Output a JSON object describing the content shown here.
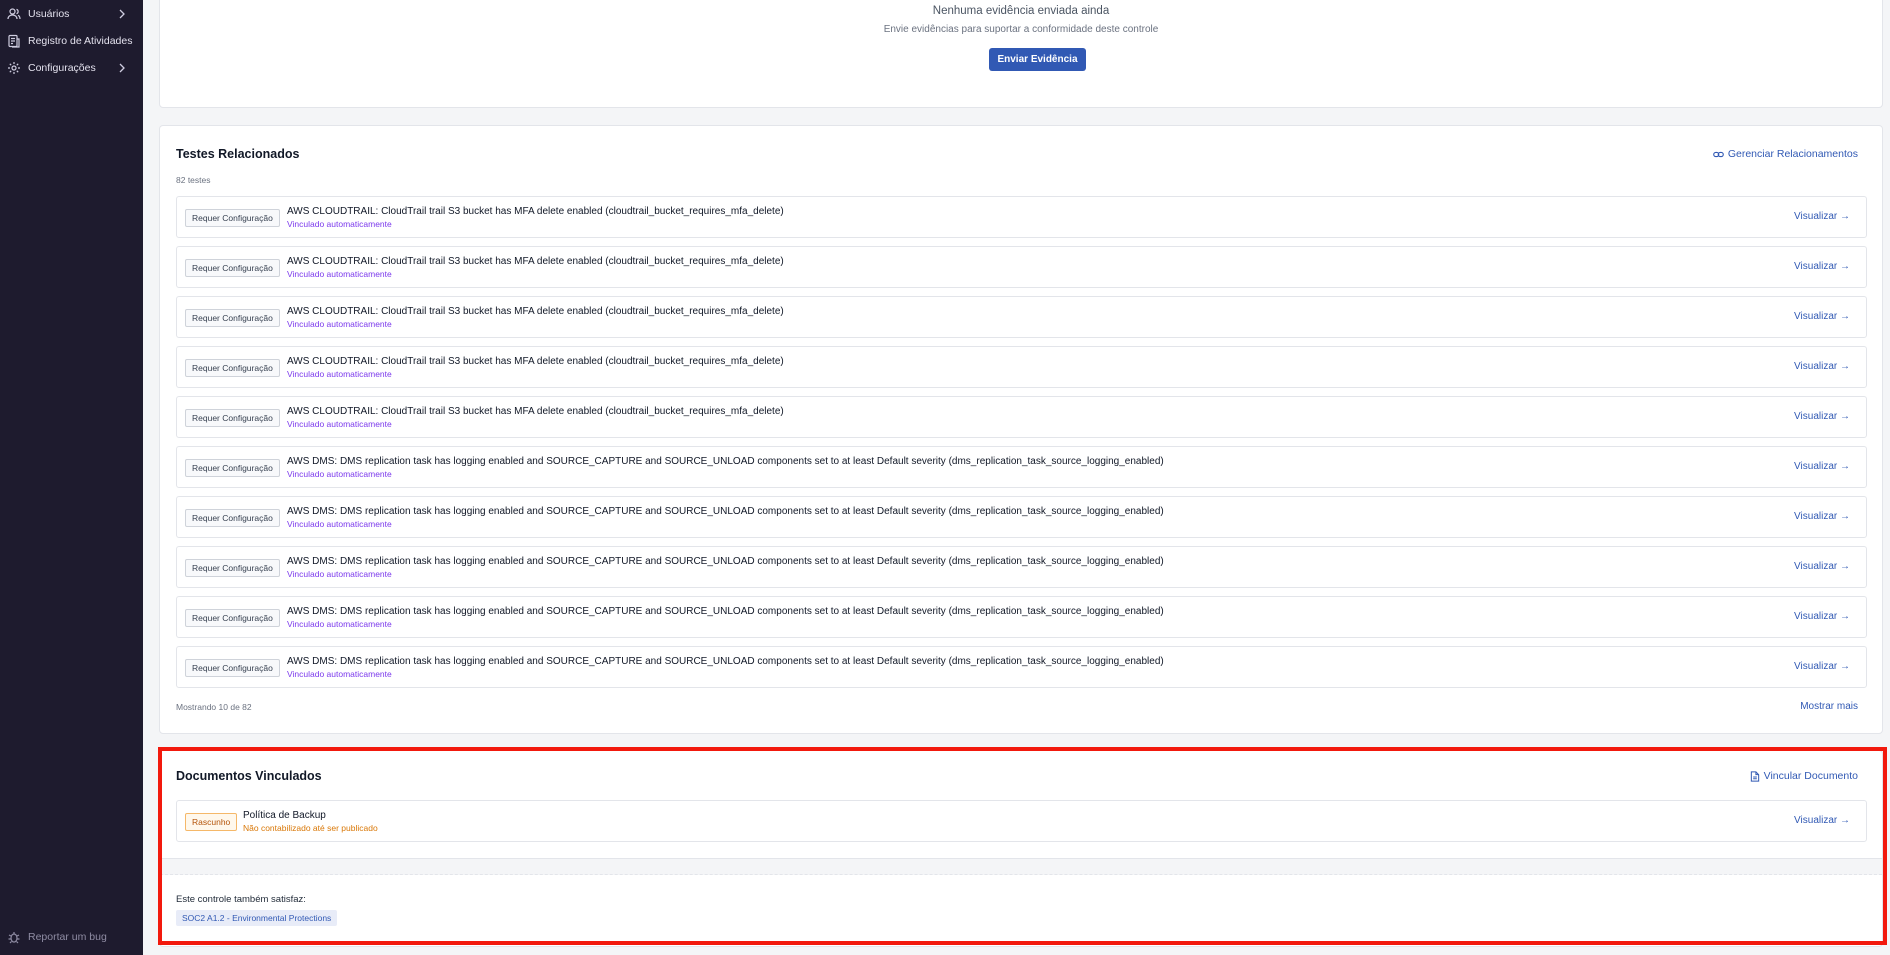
{
  "sidebar": {
    "items": [
      {
        "label": "Usuários",
        "icon": "users-icon",
        "has_chevron": true
      },
      {
        "label": "Registro de Atividades",
        "icon": "activity-log-icon",
        "has_chevron": false
      },
      {
        "label": "Configurações",
        "icon": "gear-icon",
        "has_chevron": true
      }
    ],
    "bottom": {
      "label": "Reportar um bug",
      "icon": "bug-icon"
    }
  },
  "evidence": {
    "empty_title": "Nenhuma evidência enviada ainda",
    "empty_subtitle": "Envie evidências para suportar a conformidade deste controle",
    "upload_button": "Enviar Evidência"
  },
  "tests": {
    "title": "Testes Relacionados",
    "manage_link": "Gerenciar Relacionamentos",
    "count": "82 testes",
    "items": [
      {
        "tag": "Requer Configuração",
        "title": "AWS CLOUDTRAIL: CloudTrail trail S3 bucket has MFA delete enabled (cloudtrail_bucket_requires_mfa_delete)",
        "subtitle": "Vinculado automaticamente",
        "action": "Visualizar →"
      },
      {
        "tag": "Requer Configuração",
        "title": "AWS CLOUDTRAIL: CloudTrail trail S3 bucket has MFA delete enabled (cloudtrail_bucket_requires_mfa_delete)",
        "subtitle": "Vinculado automaticamente",
        "action": "Visualizar →"
      },
      {
        "tag": "Requer Configuração",
        "title": "AWS CLOUDTRAIL: CloudTrail trail S3 bucket has MFA delete enabled (cloudtrail_bucket_requires_mfa_delete)",
        "subtitle": "Vinculado automaticamente",
        "action": "Visualizar →"
      },
      {
        "tag": "Requer Configuração",
        "title": "AWS CLOUDTRAIL: CloudTrail trail S3 bucket has MFA delete enabled (cloudtrail_bucket_requires_mfa_delete)",
        "subtitle": "Vinculado automaticamente",
        "action": "Visualizar →"
      },
      {
        "tag": "Requer Configuração",
        "title": "AWS CLOUDTRAIL: CloudTrail trail S3 bucket has MFA delete enabled (cloudtrail_bucket_requires_mfa_delete)",
        "subtitle": "Vinculado automaticamente",
        "action": "Visualizar →"
      },
      {
        "tag": "Requer Configuração",
        "title": "AWS DMS: DMS replication task has logging enabled and SOURCE_CAPTURE and SOURCE_UNLOAD components set to at least Default severity (dms_replication_task_source_logging_enabled)",
        "subtitle": "Vinculado automaticamente",
        "action": "Visualizar →"
      },
      {
        "tag": "Requer Configuração",
        "title": "AWS DMS: DMS replication task has logging enabled and SOURCE_CAPTURE and SOURCE_UNLOAD components set to at least Default severity (dms_replication_task_source_logging_enabled)",
        "subtitle": "Vinculado automaticamente",
        "action": "Visualizar →"
      },
      {
        "tag": "Requer Configuração",
        "title": "AWS DMS: DMS replication task has logging enabled and SOURCE_CAPTURE and SOURCE_UNLOAD components set to at least Default severity (dms_replication_task_source_logging_enabled)",
        "subtitle": "Vinculado automaticamente",
        "action": "Visualizar →"
      },
      {
        "tag": "Requer Configuração",
        "title": "AWS DMS: DMS replication task has logging enabled and SOURCE_CAPTURE and SOURCE_UNLOAD components set to at least Default severity (dms_replication_task_source_logging_enabled)",
        "subtitle": "Vinculado automaticamente",
        "action": "Visualizar →"
      },
      {
        "tag": "Requer Configuração",
        "title": "AWS DMS: DMS replication task has logging enabled and SOURCE_CAPTURE and SOURCE_UNLOAD components set to at least Default severity (dms_replication_task_source_logging_enabled)",
        "subtitle": "Vinculado automaticamente",
        "action": "Visualizar →"
      }
    ],
    "showing": "Mostrando 10 de 82",
    "show_more": "Mostrar mais"
  },
  "documents": {
    "title": "Documentos Vinculados",
    "link_action": "Vincular Documento",
    "items": [
      {
        "tag": "Rascunho",
        "title": "Política de Backup",
        "subtitle": "Não contabilizado até ser publicado",
        "action": "Visualizar →"
      }
    ],
    "also_satisfies_label": "Este controle também satisfaz:",
    "also_satisfies": [
      "SOC2 A1.2 - Environmental Protections"
    ]
  },
  "colors": {
    "sidebar_bg": "#1e1b2e",
    "accent": "#3159b4",
    "auto_link": "#7c3aed",
    "draft": "#d97706",
    "highlight": "#f2190d"
  }
}
